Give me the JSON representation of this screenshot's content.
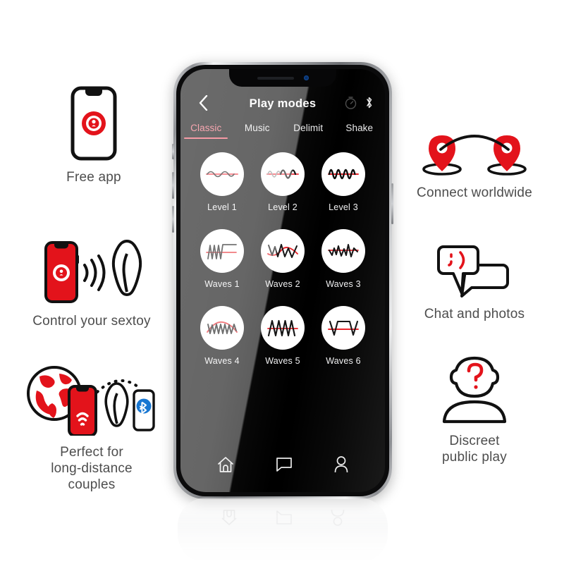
{
  "brand": {
    "red": "#E3131B",
    "accent_salmon": "#F4697A",
    "underline": "#EF5566",
    "blue": "#1877D2"
  },
  "features_left": [
    {
      "id": "free-app",
      "icon": "phone-with-lock-badge-icon",
      "caption": "Free app"
    },
    {
      "id": "control-sextoy",
      "icon": "phone-signal-toy-icon",
      "caption": "Control your sextoy"
    },
    {
      "id": "long-distance",
      "icon": "globe-phone-toy-bluetooth-icon",
      "caption": "Perfect for\nlong-distance\ncouples"
    }
  ],
  "features_right": [
    {
      "id": "connect-worldwide",
      "icon": "two-map-pins-arc-icon",
      "caption": "Connect worldwide"
    },
    {
      "id": "chat-photos",
      "icon": "speech-bubbles-wink-icon",
      "caption": "Chat and photos"
    },
    {
      "id": "discreet-play",
      "icon": "anonymous-person-question-icon",
      "caption": "Discreet\npublic play"
    }
  ],
  "phone": {
    "status": {
      "speaker": "earpiece-speaker",
      "camera": "front-camera"
    },
    "app": {
      "back_icon": "chevron-left-icon",
      "title": "Play modes",
      "top_right_icons": [
        {
          "name": "timer-icon",
          "state": "dim"
        },
        {
          "name": "bluetooth-icon",
          "state": "active"
        }
      ],
      "tabs": [
        {
          "label": "Classic",
          "active": true
        },
        {
          "label": "Music",
          "active": false
        },
        {
          "label": "Delimit",
          "active": false
        },
        {
          "label": "Shake",
          "active": false
        }
      ],
      "modes": [
        {
          "label": "Level 1",
          "icon": "wave-low-amplitude-sine-icon"
        },
        {
          "label": "Level 2",
          "icon": "wave-medium-sine-icon"
        },
        {
          "label": "Level 3",
          "icon": "wave-high-frequency-sine-icon"
        },
        {
          "label": "Waves 1",
          "icon": "wave-burst-then-flat-icon"
        },
        {
          "label": "Waves 2",
          "icon": "wave-sparse-zigzag-icon"
        },
        {
          "label": "Waves 3",
          "icon": "wave-irregular-zigzag-icon"
        },
        {
          "label": "Waves 4",
          "icon": "wave-dense-zigzag-icon"
        },
        {
          "label": "Waves 5",
          "icon": "wave-sawtooth-icon"
        },
        {
          "label": "Waves 6",
          "icon": "wave-square-pulse-icon"
        }
      ],
      "bottom_nav": [
        {
          "name": "home-icon",
          "active": true
        },
        {
          "name": "chat-icon",
          "active": false
        },
        {
          "name": "profile-icon",
          "active": false
        }
      ]
    }
  }
}
